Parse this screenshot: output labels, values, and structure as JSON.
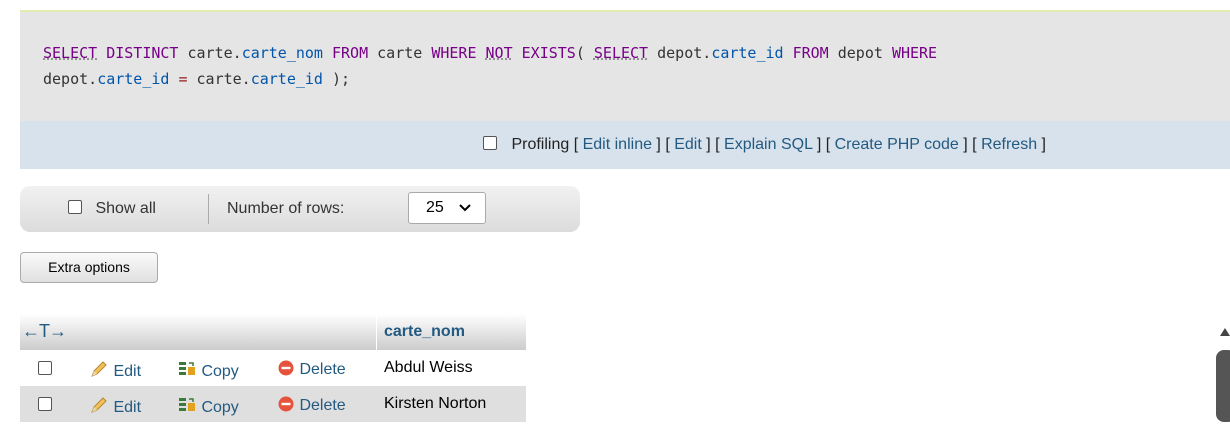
{
  "sql": {
    "line1": [
      {
        "t": "SELECT",
        "c": "kw-ul"
      },
      {
        "t": " ",
        "c": "txt"
      },
      {
        "t": "DISTINCT",
        "c": "kw"
      },
      {
        "t": " carte.",
        "c": "txt"
      },
      {
        "t": "carte_nom",
        "c": "col"
      },
      {
        "t": " ",
        "c": "txt"
      },
      {
        "t": "FROM",
        "c": "kw"
      },
      {
        "t": " carte ",
        "c": "txt"
      },
      {
        "t": "WHERE",
        "c": "kw"
      },
      {
        "t": " ",
        "c": "txt"
      },
      {
        "t": "NOT",
        "c": "kw-ul"
      },
      {
        "t": " ",
        "c": "txt"
      },
      {
        "t": "EXISTS",
        "c": "kw"
      },
      {
        "t": "( ",
        "c": "txt"
      },
      {
        "t": "SELECT",
        "c": "kw-ul"
      },
      {
        "t": " depot.",
        "c": "txt"
      },
      {
        "t": "carte_id",
        "c": "col"
      },
      {
        "t": " ",
        "c": "txt"
      },
      {
        "t": "FROM",
        "c": "kw"
      },
      {
        "t": " depot ",
        "c": "txt"
      },
      {
        "t": "WHERE",
        "c": "kw"
      }
    ],
    "line2": [
      {
        "t": "depot.",
        "c": "txt"
      },
      {
        "t": "carte_id",
        "c": "col"
      },
      {
        "t": " ",
        "c": "txt"
      },
      {
        "t": "=",
        "c": "op"
      },
      {
        "t": " carte.",
        "c": "txt"
      },
      {
        "t": "carte_id",
        "c": "col"
      },
      {
        "t": " );",
        "c": "txt"
      }
    ]
  },
  "tools": {
    "profiling_label": "Profiling",
    "links": [
      "Edit inline",
      "Edit",
      "Explain SQL",
      "Create PHP code",
      "Refresh"
    ]
  },
  "nav": {
    "show_all_label": "Show all",
    "rows_label": "Number of rows:",
    "rows_value": "25"
  },
  "extra_options_label": "Extra options",
  "table": {
    "sort_arrows": "←T→",
    "column": "carte_nom",
    "actions": {
      "edit": "Edit",
      "copy": "Copy",
      "delete": "Delete"
    },
    "rows": [
      "Abdul Weiss",
      "Kirsten Norton"
    ]
  },
  "colors": {
    "link": "#235a81",
    "keyword": "#770088",
    "column": "#0055aa",
    "sql_bg": "#e5e5e5",
    "tools_bg": "#d7e2ec"
  }
}
